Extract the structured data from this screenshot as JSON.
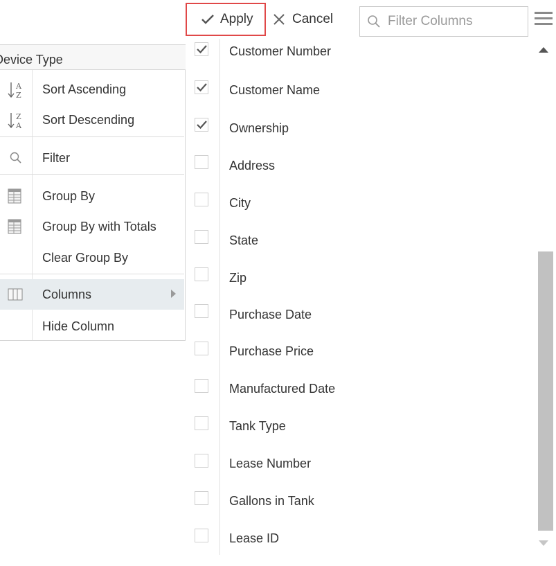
{
  "toolbar": {
    "apply_label": "Apply",
    "cancel_label": "Cancel",
    "filter_placeholder": "Filter Columns"
  },
  "context_menu": {
    "header": "Device Type",
    "sort_ascending": "Sort Ascending",
    "sort_descending": "Sort Descending",
    "filter": "Filter",
    "group_by": "Group By",
    "group_by_totals": "Group By with Totals",
    "clear_group_by": "Clear Group By",
    "columns": "Columns",
    "hide_column": "Hide Column"
  },
  "columns": [
    {
      "label": "Customer Number",
      "checked": true
    },
    {
      "label": "Customer Name",
      "checked": true
    },
    {
      "label": "Ownership",
      "checked": true
    },
    {
      "label": "Address",
      "checked": false
    },
    {
      "label": "City",
      "checked": false
    },
    {
      "label": "State",
      "checked": false
    },
    {
      "label": "Zip",
      "checked": false
    },
    {
      "label": "Purchase Date",
      "checked": false
    },
    {
      "label": "Purchase Price",
      "checked": false
    },
    {
      "label": "Manufactured Date",
      "checked": false
    },
    {
      "label": "Tank Type",
      "checked": false
    },
    {
      "label": "Lease Number",
      "checked": false
    },
    {
      "label": "Gallons in Tank",
      "checked": false
    },
    {
      "label": "Lease ID",
      "checked": false
    }
  ],
  "colors": {
    "highlight_border": "#e04848",
    "active_row": "#e7ecef",
    "scroll_thumb": "#c1c1c1"
  }
}
